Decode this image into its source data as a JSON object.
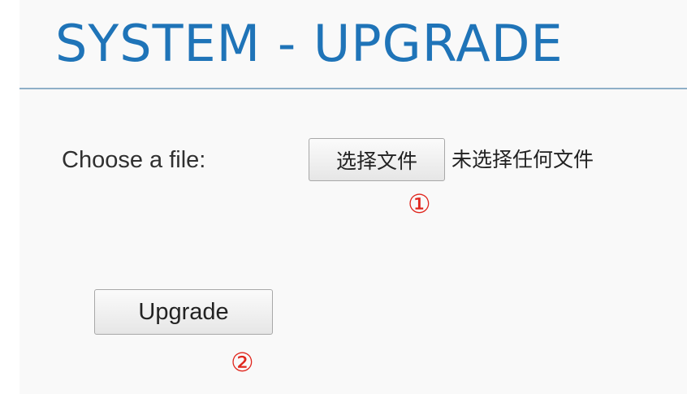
{
  "page": {
    "title": "SYSTEM - UPGRADE"
  },
  "file_input": {
    "label": "Choose a file:",
    "button_label": "选择文件",
    "status": "未选择任何文件"
  },
  "upgrade": {
    "button_label": "Upgrade"
  },
  "annotations": {
    "step1": "①",
    "step2": "②",
    "color": "#e0261d"
  },
  "colors": {
    "title": "#1f74b8",
    "divider": "#8fb0c8"
  }
}
